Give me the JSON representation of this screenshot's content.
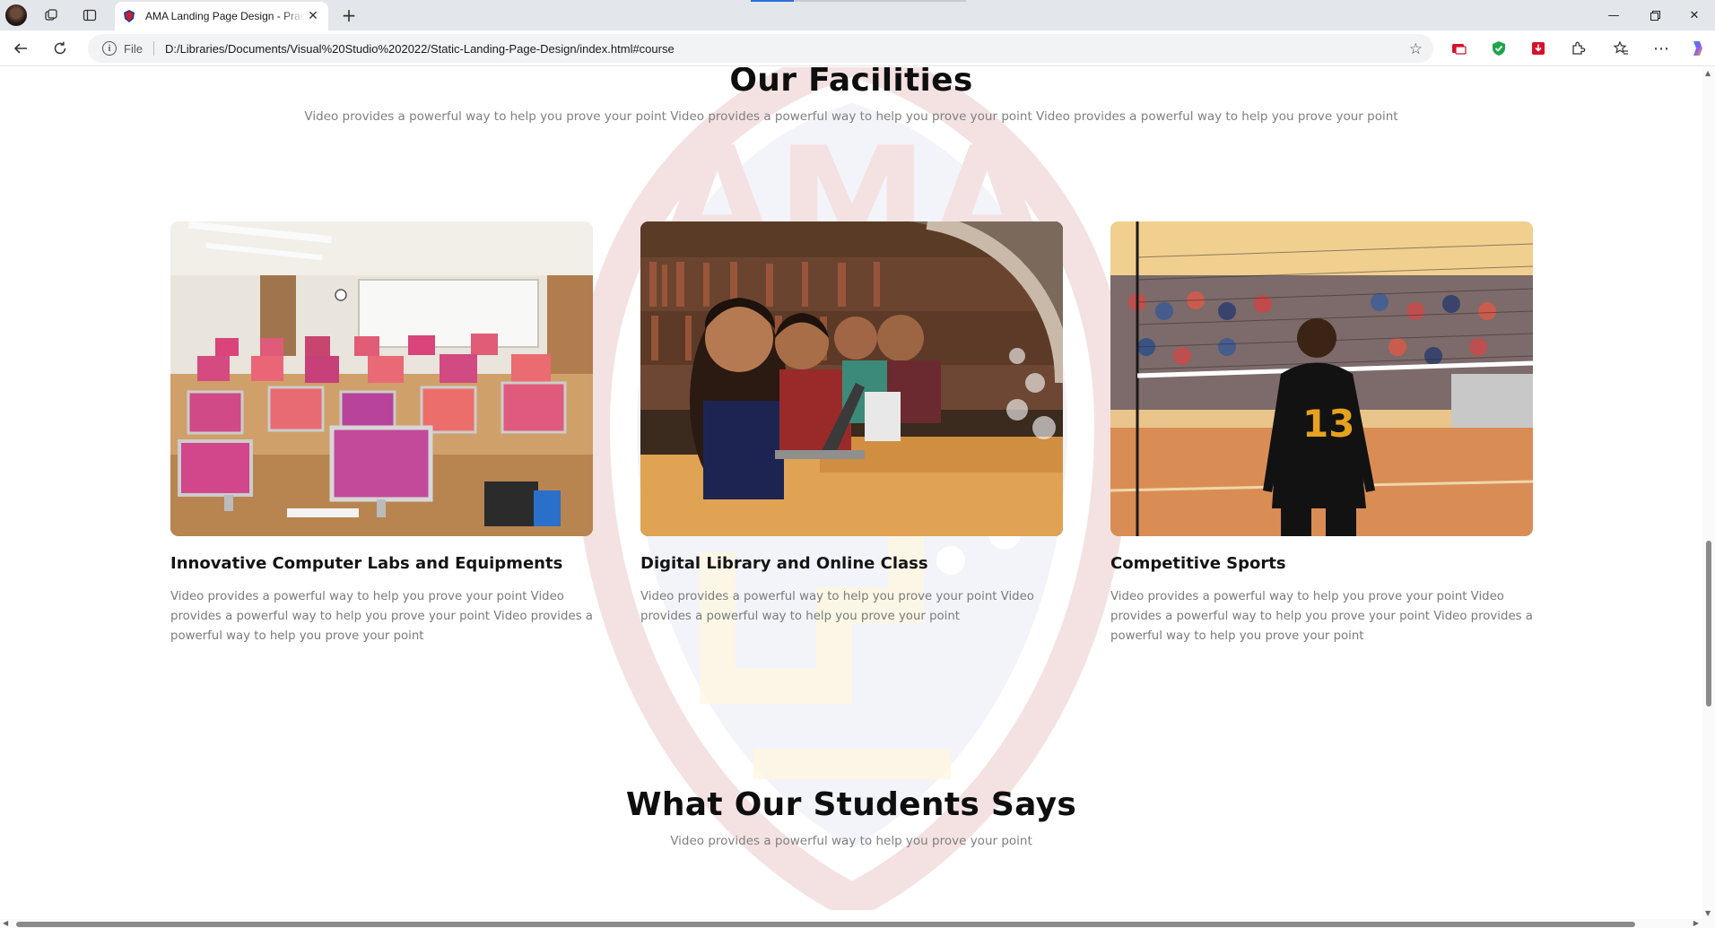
{
  "browser": {
    "tab_title": "AMA Landing Page Design - Practice",
    "url_protocol": "File",
    "url": "D:/Libraries/Documents/Visual%20Studio%202022/Static-Landing-Page-Design/index.html#course",
    "icons": [
      "avatar",
      "workspaces-icon",
      "tab-actions-icon",
      "shield-favicon",
      "close-icon",
      "new-tab-icon",
      "minimize-icon",
      "restore-icon",
      "close-window-icon",
      "back-icon",
      "refresh-icon",
      "info-icon",
      "star-icon",
      "collections-icon",
      "shield-check-icon",
      "download-icon",
      "extensions-icon",
      "favorites-icon",
      "more-icon",
      "copilot-icon"
    ],
    "accent_color": "#2b72d6"
  },
  "facilities": {
    "title": "Our Facilities",
    "subtitle": "Video provides a powerful way to help you prove your point Video provides a powerful way to help you prove your point Video provides a powerful way to help you prove your point",
    "cards": [
      {
        "title": "Innovative Computer Labs and Equipments",
        "text": "Video provides a powerful way to help you prove your point Video provides a powerful way to help you prove your point Video provides a powerful way to help you prove your point",
        "image": "computer-lab-photo"
      },
      {
        "title": "Digital Library and Online Class",
        "text": "Video provides a powerful way to help you prove your point Video provides a powerful way to help you prove your point",
        "image": "library-students-photo"
      },
      {
        "title": "Competitive Sports",
        "text": "Video provides a powerful way to help you prove your point Video provides a powerful way to help you prove your point Video provides a powerful way to help you prove your point",
        "image": "volleyball-player-photo",
        "jersey_number": "13"
      }
    ]
  },
  "testimonials": {
    "title": "What Our Students Says",
    "subtitle": "Video provides a powerful way to help you prove your point"
  }
}
